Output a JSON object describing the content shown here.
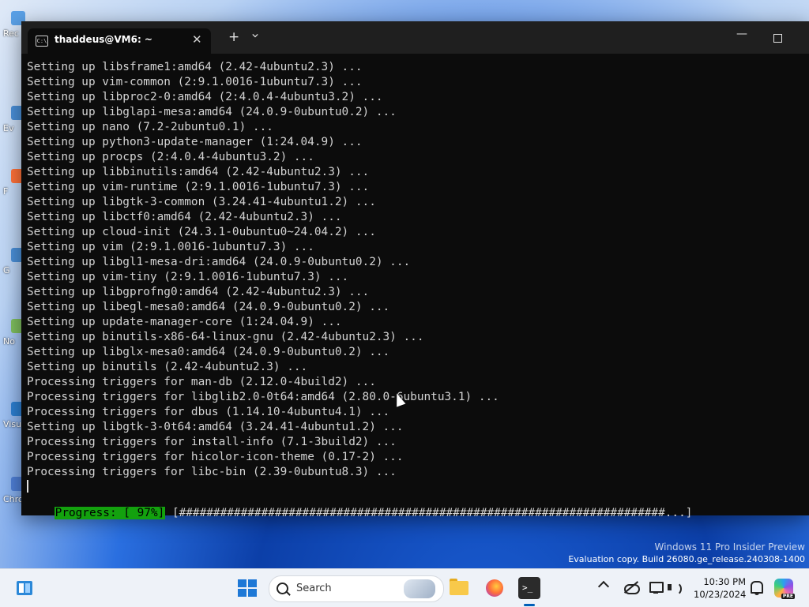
{
  "desktop": {
    "icons": [
      {
        "label": "Rec",
        "icon": "recycle-bin-icon",
        "color": "#5aa0e6"
      },
      {
        "label": "Ev",
        "icon": "shortcut-icon",
        "color": "#4a8fd8"
      },
      {
        "label": "F",
        "icon": "firefox-shortcut-icon",
        "color": "#ff7139"
      },
      {
        "label": "G",
        "icon": "shortcut-icon",
        "color": "#4a8fd8"
      },
      {
        "label": "No",
        "icon": "notepad-icon",
        "color": "#7fbf5f"
      },
      {
        "label": "Visu",
        "icon": "visual-studio-icon",
        "color": "#2d7fd1"
      },
      {
        "label": "Chromium",
        "icon": "chromium-icon",
        "color": "#4f7fd6"
      }
    ]
  },
  "window": {
    "tab_title": "thaddeus@VM6: ~",
    "tab_icon": "terminal-tab-icon",
    "tab_icon_text": "C:\\",
    "close_glyph": "✕",
    "new_tab_glyph": "+",
    "minimize_glyph": "—"
  },
  "terminal": {
    "lines": [
      "Setting up libsframe1:amd64 (2.42-4ubuntu2.3) ...",
      "Setting up vim-common (2:9.1.0016-1ubuntu7.3) ...",
      "Setting up libproc2-0:amd64 (2:4.0.4-4ubuntu3.2) ...",
      "Setting up libglapi-mesa:amd64 (24.0.9-0ubuntu0.2) ...",
      "Setting up nano (7.2-2ubuntu0.1) ...",
      "Setting up python3-update-manager (1:24.04.9) ...",
      "Setting up procps (2:4.0.4-4ubuntu3.2) ...",
      "Setting up libbinutils:amd64 (2.42-4ubuntu2.3) ...",
      "Setting up vim-runtime (2:9.1.0016-1ubuntu7.3) ...",
      "Setting up libgtk-3-common (3.24.41-4ubuntu1.2) ...",
      "Setting up libctf0:amd64 (2.42-4ubuntu2.3) ...",
      "Setting up cloud-init (24.3.1-0ubuntu0~24.04.2) ...",
      "Setting up vim (2:9.1.0016-1ubuntu7.3) ...",
      "Setting up libgl1-mesa-dri:amd64 (24.0.9-0ubuntu0.2) ...",
      "Setting up vim-tiny (2:9.1.0016-1ubuntu7.3) ...",
      "Setting up libgprofng0:amd64 (2.42-4ubuntu2.3) ...",
      "Setting up libegl-mesa0:amd64 (24.0.9-0ubuntu0.2) ...",
      "Setting up update-manager-core (1:24.04.9) ...",
      "Setting up binutils-x86-64-linux-gnu (2.42-4ubuntu2.3) ...",
      "Setting up libglx-mesa0:amd64 (24.0.9-0ubuntu0.2) ...",
      "Setting up binutils (2.42-4ubuntu2.3) ...",
      "Processing triggers for man-db (2.12.0-4build2) ...",
      "Processing triggers for libglib2.0-0t64:amd64 (2.80.0-6ubuntu3.1) ...",
      "Processing triggers for dbus (1.14.10-4ubuntu4.1) ...",
      "Setting up libgtk-3-0t64:amd64 (3.24.41-4ubuntu1.2) ...",
      "Processing triggers for install-info (7.1-3build2) ...",
      "Processing triggers for hicolor-icon-theme (0.17-2) ...",
      "Processing triggers for libc-bin (2.39-0ubuntu8.3) ..."
    ],
    "progress_label": "Progress: [ 97%]",
    "progress_bar": " [#######################################################################...]",
    "progress_percent": 97,
    "progress_color": "#13a10e"
  },
  "watermark": {
    "line1": "Windows 11 Pro Insider Preview",
    "line2": "Evaluation copy. Build 26080.ge_release.240308-1400"
  },
  "taskbar": {
    "search_placeholder": "Search",
    "time": "10:30 PM",
    "date": "10/23/2024",
    "copilot_badge": "PRE",
    "accent": "#005fb8"
  }
}
